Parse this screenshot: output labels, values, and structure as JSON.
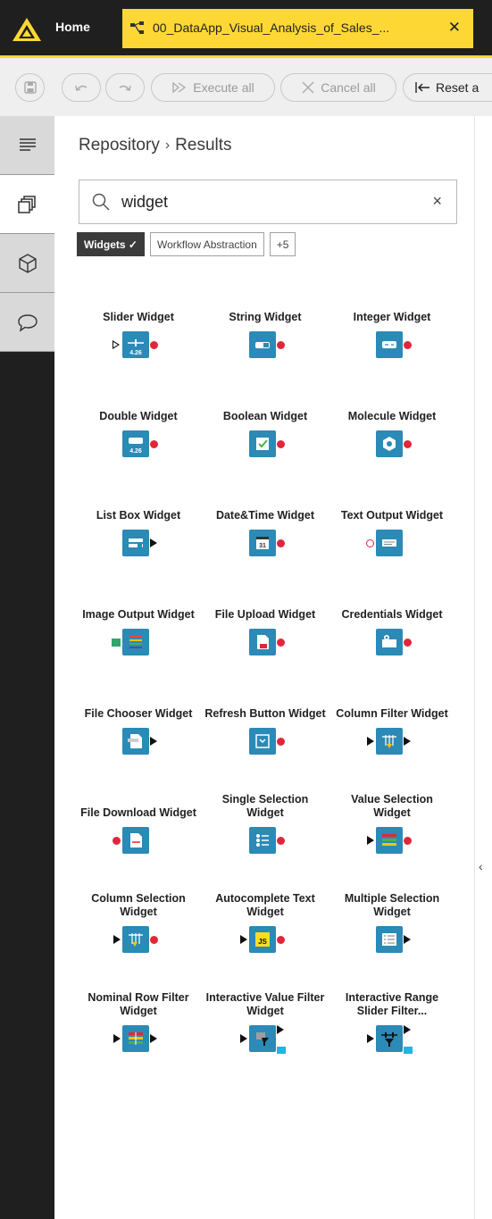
{
  "app": {
    "home_tab": "Home",
    "active_tab": "00_DataApp_Visual_Analysis_of_Sales_...",
    "close_glyph": "✕"
  },
  "toolbar": {
    "execute_all": "Execute all",
    "cancel_all": "Cancel all",
    "reset_all": "Reset a"
  },
  "breadcrumb": {
    "root": "Repository",
    "separator": "›",
    "current": "Results"
  },
  "search": {
    "value": "widget",
    "clear_glyph": "×"
  },
  "filters": {
    "active": "Widgets ✓",
    "other": "Workflow Abstraction",
    "more": "+5"
  },
  "nodes": [
    {
      "label": "Slider Widget",
      "in": "hollow-tri",
      "out": "red",
      "icon": "slider-icon"
    },
    {
      "label": "String Widget",
      "in": "",
      "out": "red",
      "icon": "string-icon"
    },
    {
      "label": "Integer Widget",
      "in": "",
      "out": "red",
      "icon": "integer-icon"
    },
    {
      "label": "Double Widget",
      "in": "",
      "out": "red",
      "icon": "double-icon"
    },
    {
      "label": "Boolean Widget",
      "in": "",
      "out": "red",
      "icon": "boolean-icon"
    },
    {
      "label": "Molecule Widget",
      "in": "",
      "out": "red",
      "icon": "molecule-icon"
    },
    {
      "label": "List Box Widget",
      "in": "",
      "out": "black",
      "icon": "listbox-icon"
    },
    {
      "label": "Date&Time Widget",
      "in": "",
      "out": "red",
      "icon": "calendar-icon"
    },
    {
      "label": "Text Output Widget",
      "in": "hollow-circle",
      "out": "",
      "icon": "text-output-icon"
    },
    {
      "label": "Image Output Widget",
      "in": "green",
      "out": "",
      "icon": "image-output-icon"
    },
    {
      "label": "File Upload Widget",
      "in": "",
      "out": "red",
      "icon": "file-upload-icon"
    },
    {
      "label": "Credentials Widget",
      "in": "",
      "out": "red",
      "icon": "credentials-icon"
    },
    {
      "label": "File Chooser Widget",
      "in": "",
      "out": "black",
      "icon": "file-chooser-icon"
    },
    {
      "label": "Refresh Button Widget",
      "in": "",
      "out": "red",
      "icon": "refresh-icon"
    },
    {
      "label": "Column Filter Widget",
      "in": "black",
      "out": "black",
      "icon": "column-filter-icon"
    },
    {
      "label": "File Download Widget",
      "in": "red",
      "out": "",
      "icon": "file-download-icon"
    },
    {
      "label": "Single Selection Widget",
      "in": "",
      "out": "red",
      "icon": "single-selection-icon"
    },
    {
      "label": "Value Selection Widget",
      "in": "black",
      "out": "red",
      "icon": "value-selection-icon"
    },
    {
      "label": "Column Selection Widget",
      "in": "black",
      "out": "red",
      "icon": "column-selection-icon"
    },
    {
      "label": "Autocomplete Text Widget",
      "in": "black",
      "out": "red",
      "icon": "js-icon"
    },
    {
      "label": "Multiple Selection Widget",
      "in": "",
      "out": "black",
      "icon": "multiple-selection-icon"
    },
    {
      "label": "Nominal Row Filter Widget",
      "in": "black",
      "out": "black",
      "icon": "nominal-row-filter-icon"
    },
    {
      "label": "Interactive Value Filter Widget",
      "in": "black",
      "out": "black-cyan",
      "icon": "interactive-value-filter-icon"
    },
    {
      "label": "Interactive Range Slider Filter...",
      "in": "black",
      "out": "black-cyan",
      "icon": "interactive-range-slider-icon"
    }
  ],
  "icon_texts": {
    "slider_value": "4.26",
    "double_value": "4.26",
    "calendar_day": "31",
    "js": "JS"
  },
  "colors": {
    "top_bar": "#1f1f1f",
    "active_tab": "#fdd835",
    "node_box": "#2b8ab6",
    "port_red": "#e0273a",
    "port_green": "#2fa66b",
    "port_cyan": "#1fb5e6"
  }
}
